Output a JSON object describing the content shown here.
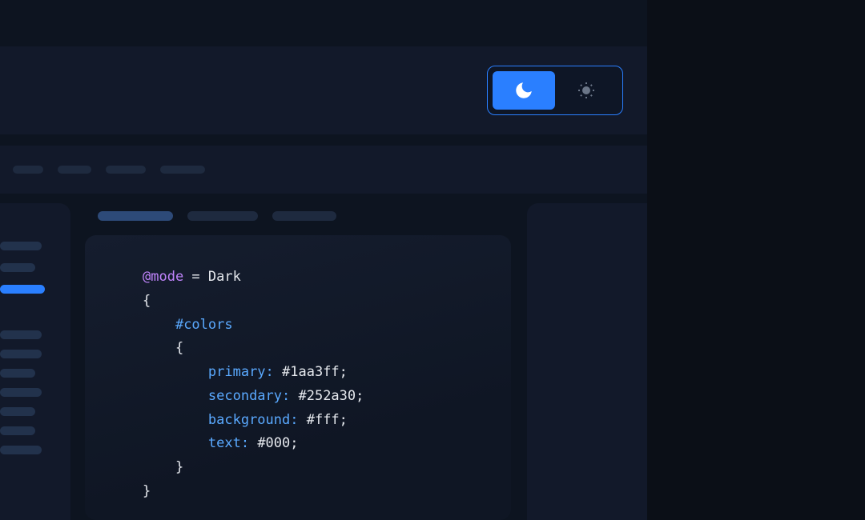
{
  "theme": {
    "active": "dark",
    "options": [
      "dark",
      "light"
    ]
  },
  "code": {
    "mode_keyword": "@mode",
    "equals": " = ",
    "mode_value": "Dark",
    "open1": "{",
    "colors_selector": "#colors",
    "open2": "{",
    "primary_key": "primary:",
    "primary_val": " #1aa3ff;",
    "secondary_key": "secondary:",
    "secondary_val": " #252a30;",
    "background_key": "background:",
    "background_val": " #fff;",
    "text_key": "text:",
    "text_val": " #000;",
    "close2": "}",
    "close1": "}"
  },
  "colors": {
    "accent": "#2a7fff",
    "bg_dark": "#0b0f17",
    "panel": "#12192a"
  }
}
